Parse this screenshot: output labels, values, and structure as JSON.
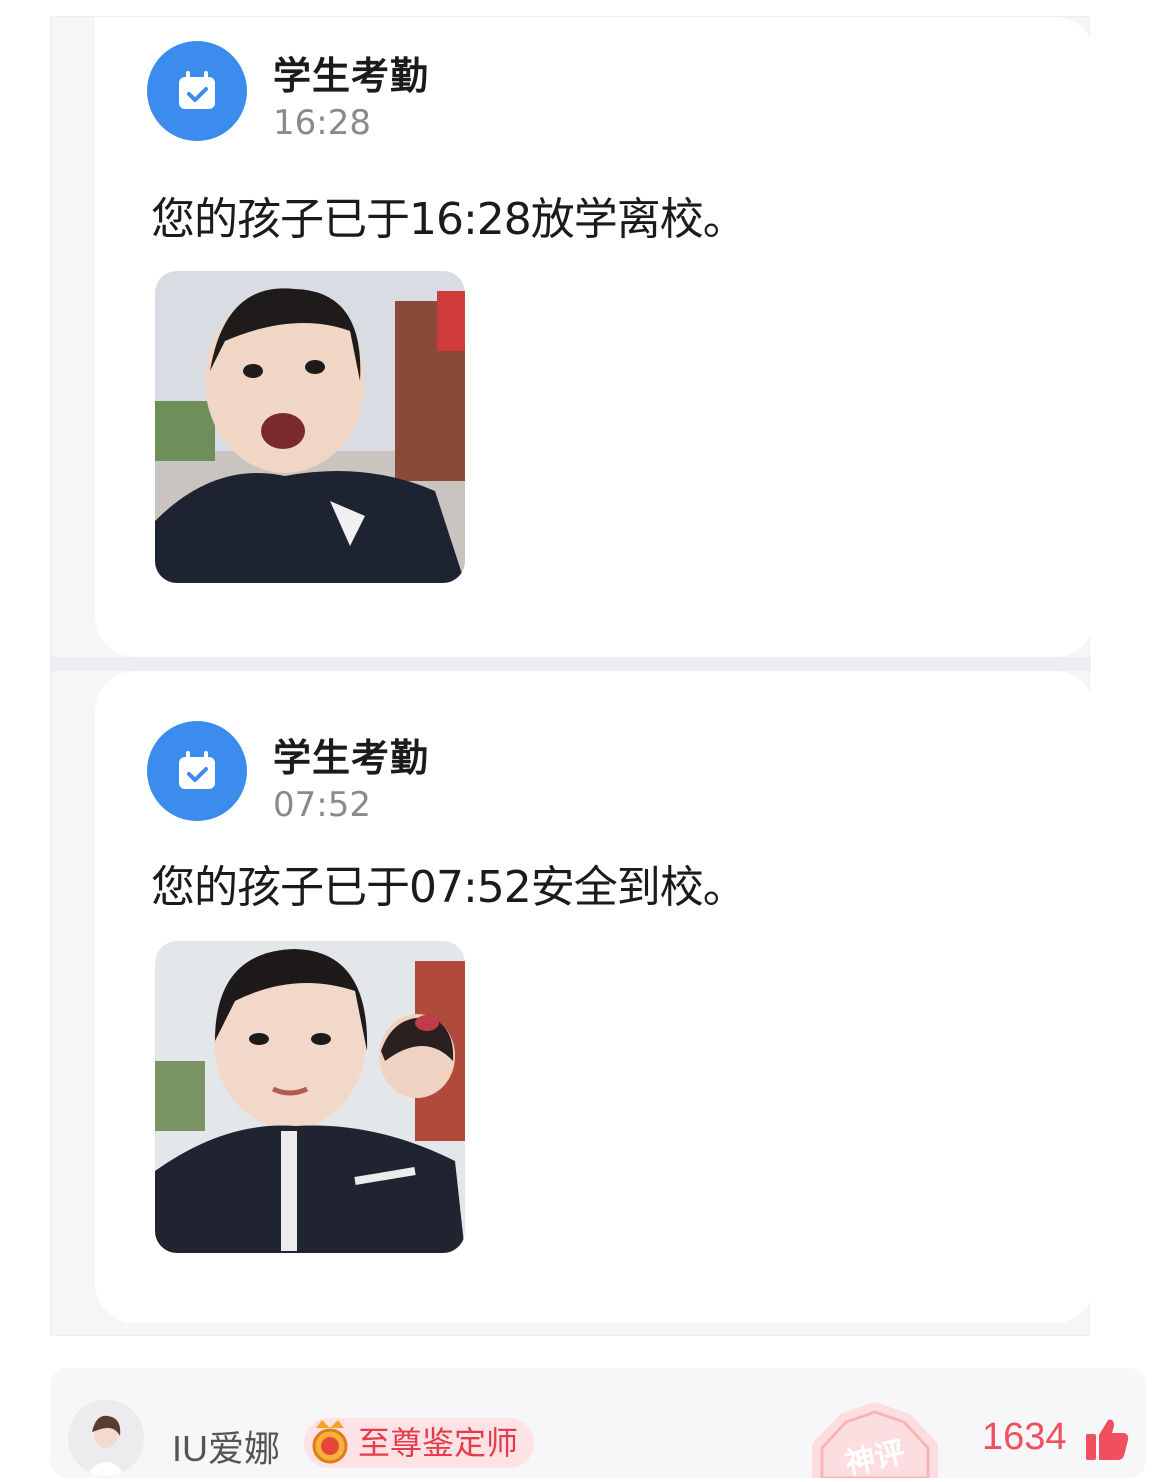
{
  "notifications": [
    {
      "app_name": "学生考勤",
      "time": "16:28",
      "message": "您的孩子已于16:28放学离校。",
      "photo_icon": "child-photo"
    },
    {
      "app_name": "学生考勤",
      "time": "07:52",
      "message": "您的孩子已于07:52安全到校。",
      "photo_icon": "child-photo"
    }
  ],
  "icons": {
    "app": "calendar-check-icon",
    "like": "thumbs-up-icon",
    "badge": "crown-medal-icon",
    "stamp": "god-comment-stamp"
  },
  "comment": {
    "username": "IU爱娜",
    "badge_label": "至尊鉴定师",
    "stamp_label": "神评",
    "like_count": "1634"
  },
  "colors": {
    "app_icon": "#3b8cec",
    "accent_red": "#ef4f5e",
    "badge_bg": "#fde3e5"
  }
}
